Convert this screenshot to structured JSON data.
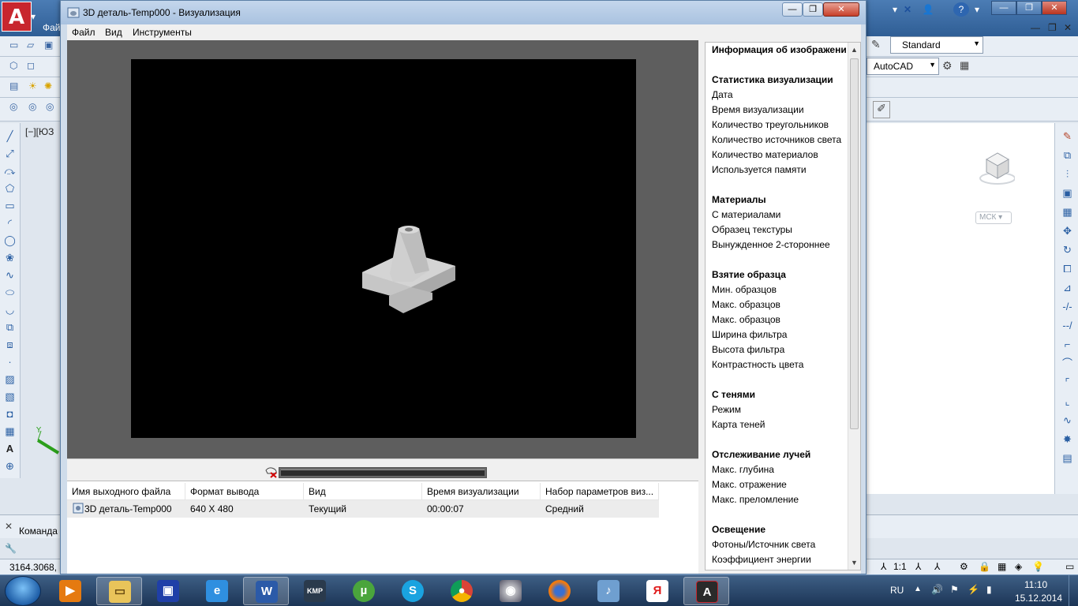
{
  "acad": {
    "style_dropdown": "Standard",
    "workspace_dropdown": "AutoCAD",
    "viewport_label": "[−][ЮЗ",
    "ucs_label": "МСК",
    "command_label": "Команда",
    "coords": "3164.3068, 3",
    "scale": "1:1",
    "file_menu_stub": "Фай"
  },
  "render_window": {
    "title": "3D деталь-Temp000 - Визуализация",
    "menu": [
      "Файл",
      "Вид",
      "Инструменты"
    ],
    "history_columns": [
      "Имя выходного файла",
      "Формат вывода",
      "Вид",
      "Время визуализации",
      "Набор параметров виз..."
    ],
    "history_rows": [
      {
        "file": "3D деталь-Temp000",
        "format": "640 X 480",
        "view": "Текущий",
        "time": "00:00:07",
        "preset": "Средний"
      }
    ],
    "info_panel": {
      "header": "Информация об изображени",
      "sections": [
        {
          "title": "Статистика визуализации",
          "items": [
            "Дата",
            "Время визуализации",
            "Количество треугольников",
            "Количество источников света",
            "Количество материалов",
            "Используется памяти"
          ]
        },
        {
          "title": "Материалы",
          "items": [
            "С материалами",
            "Образец текстуры",
            "Вынужденное 2-стороннее"
          ]
        },
        {
          "title": "Взятие образца",
          "items": [
            "Мин. образцов",
            "Макс. образцов",
            "Макс. образцов",
            "Ширина фильтра",
            "Высота фильтра",
            "Контрастность цвета"
          ]
        },
        {
          "title": "С тенями",
          "items": [
            "Режим",
            "Карта теней"
          ]
        },
        {
          "title": "Отслеживание лучей",
          "items": [
            "Макс. глубина",
            "Макс. отражение",
            "Макс. преломление"
          ]
        },
        {
          "title": "Освещение",
          "items": [
            "Фотоны/Источник света",
            "Коэффициент энергии"
          ]
        }
      ]
    }
  },
  "taskbar": {
    "language": "RU",
    "time": "11:10",
    "date": "15.12.2014",
    "apps": [
      "media-player",
      "explorer",
      "save-disk",
      "internet-explorer",
      "word",
      "kmplayer",
      "utorrent",
      "skype",
      "chrome",
      "disc-app",
      "firefox",
      "speaker-app",
      "yandex",
      "autocad"
    ]
  }
}
